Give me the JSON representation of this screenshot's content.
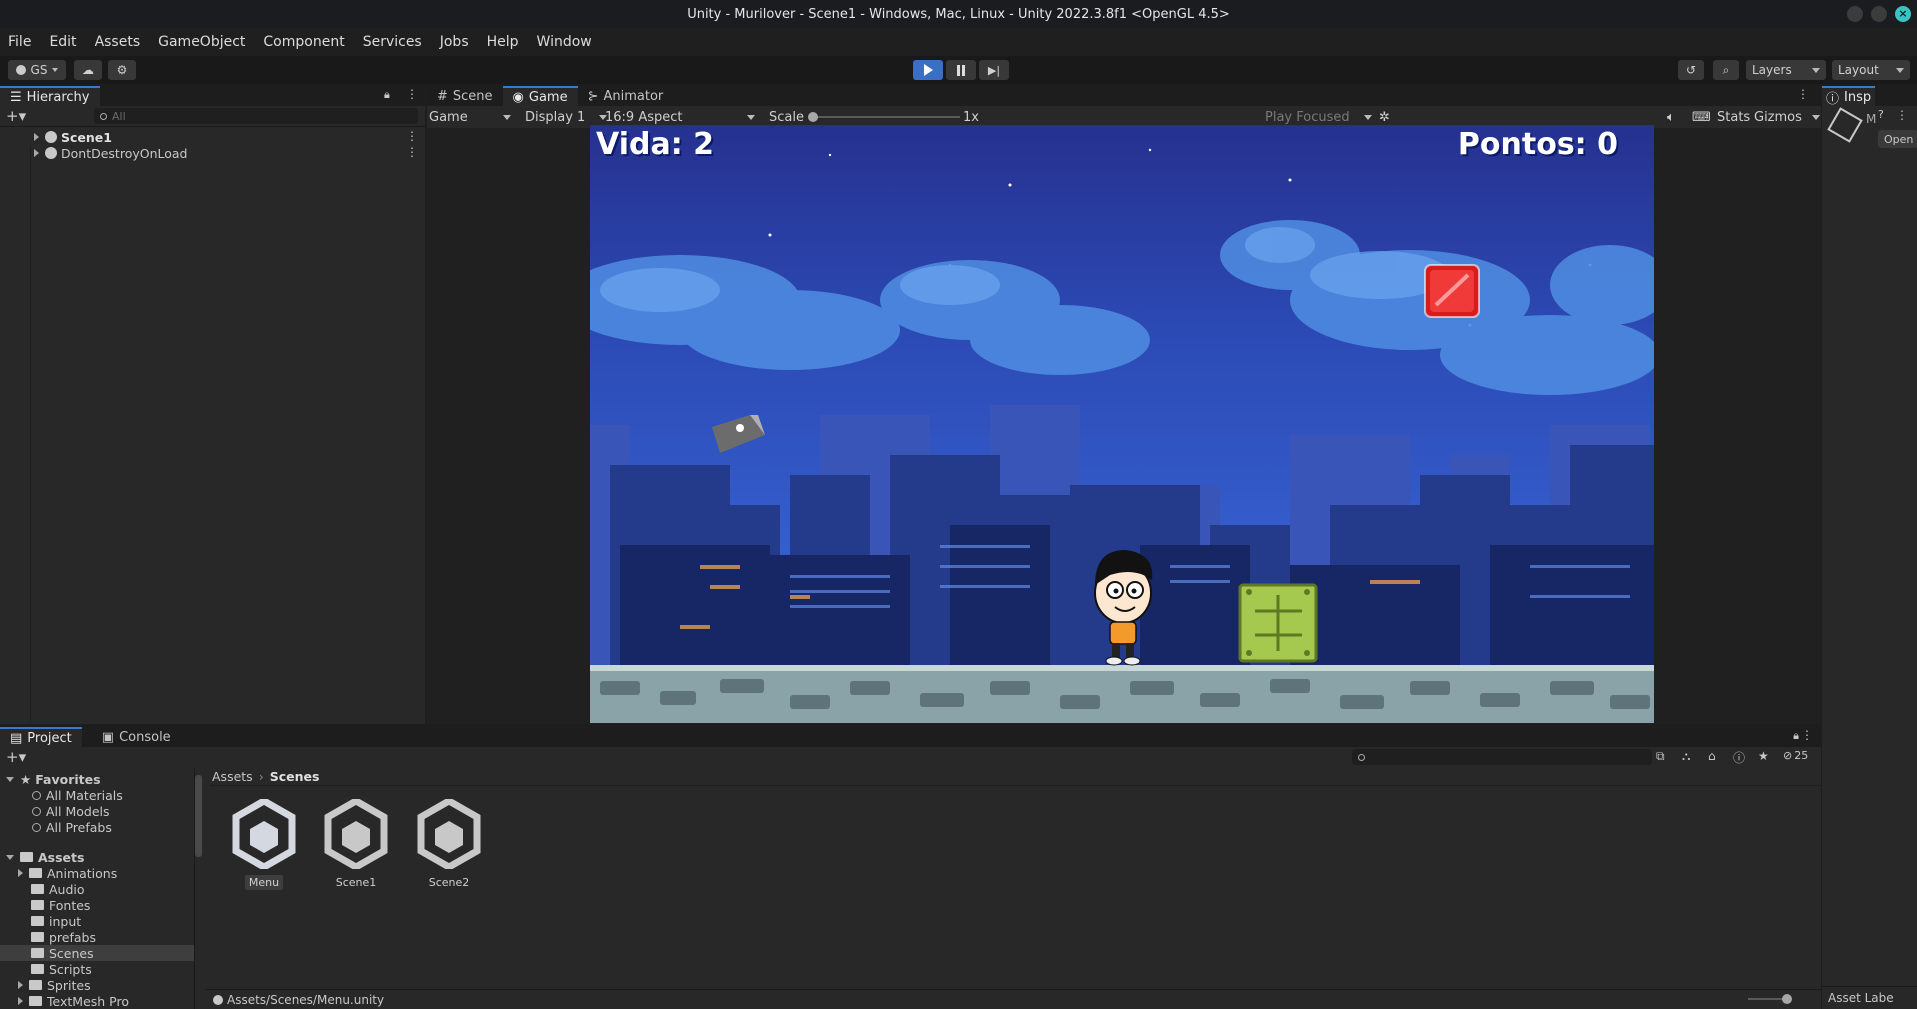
{
  "window": {
    "title": "Unity - Murilover - Scene1 - Windows, Mac, Linux - Unity 2022.3.8f1 <OpenGL 4.5>"
  },
  "menu": [
    "File",
    "Edit",
    "Assets",
    "GameObject",
    "Component",
    "Services",
    "Jobs",
    "Help",
    "Window"
  ],
  "toolbar": {
    "account": "GS",
    "layers": "Layers",
    "layout": "Layout"
  },
  "hierarchy": {
    "tab": "Hierarchy",
    "search_placeholder": "All",
    "items": [
      "Scene1",
      "DontDestroyOnLoad"
    ]
  },
  "center_tabs": [
    "Scene",
    "Game",
    "Animator"
  ],
  "game_toolbar": {
    "mode": "Game",
    "display": "Display 1",
    "aspect": "16:9 Aspect",
    "scale_label": "Scale",
    "scale_value": "1x",
    "play_mode": "Play Focused",
    "stats": "Stats",
    "gizmos": "Gizmos"
  },
  "hud": {
    "lives": "Vida: 2",
    "points": "Pontos: 0"
  },
  "inspector": {
    "tab": "Insp",
    "title": "M",
    "open_button": "Open",
    "asset_labels": "Asset Labe"
  },
  "bottom_tabs": [
    "Project",
    "Console"
  ],
  "project": {
    "favorites_label": "Favorites",
    "favorites": [
      "All Materials",
      "All Models",
      "All Prefabs"
    ],
    "assets_label": "Assets",
    "folders": [
      "Animations",
      "Audio",
      "Fontes",
      "input",
      "prefabs",
      "Scenes",
      "Scripts",
      "Sprites",
      "TextMesh Pro"
    ],
    "selected_folder": "Scenes",
    "breadcrumb": [
      "Assets",
      "Scenes"
    ],
    "files": [
      "Menu",
      "Scene1",
      "Scene2"
    ],
    "selected_file": "Menu",
    "status_path": "Assets/Scenes/Menu.unity",
    "hidden_count": "25"
  },
  "colors": {
    "accent": "#3a78d2",
    "sky": "#2f52b8",
    "play_button": "#3a6fc4"
  }
}
